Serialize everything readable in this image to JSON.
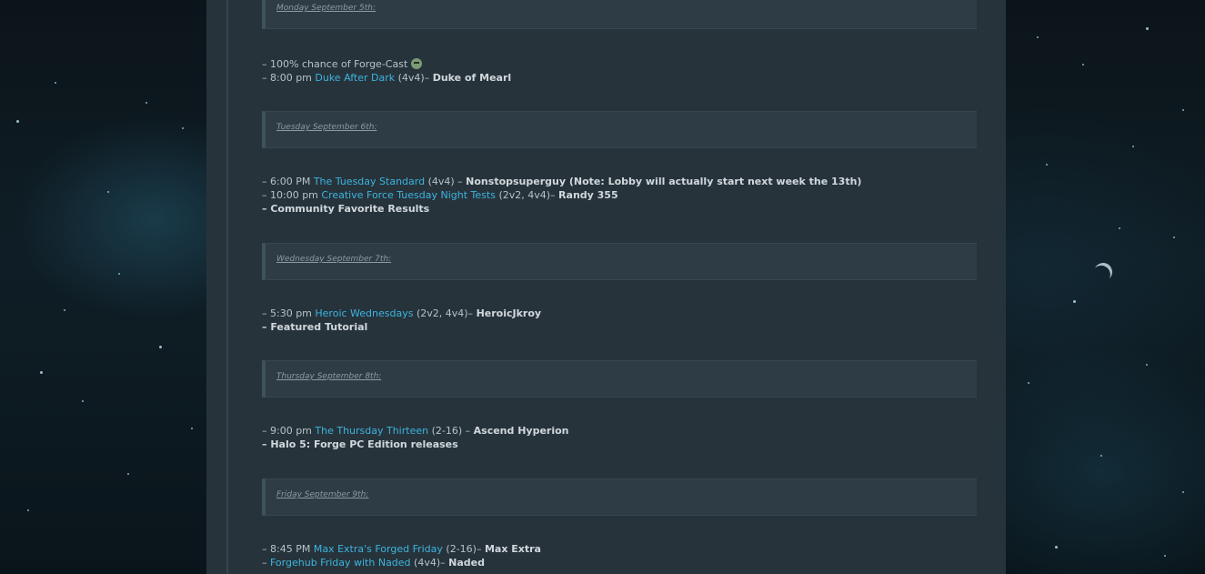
{
  "days": [
    {
      "header": "Monday September 5th:",
      "lines": [
        {
          "pre": "– 100% chance of Forge-Cast",
          "emoji": "smiley-icon"
        },
        {
          "pre": "– 8:00 pm ",
          "link": "Duke After Dark",
          "mid": " (4v4)– ",
          "bold": "Duke of Mearl"
        }
      ]
    },
    {
      "header": "Tuesday September 6th:",
      "lines": [
        {
          "pre": "– 6:00 PM ",
          "link": "The Tuesday Standard",
          "mid": " (4v4) – ",
          "bold": "Nonstopsuperguy (Note: Lobby will actually start next week the 13th)"
        },
        {
          "pre": "– 10:00 pm ",
          "link": "Creative Force Tuesday Night Tests",
          "mid": " (2v2, 4v4)– ",
          "bold": "Randy 355"
        },
        {
          "bold": "– Community Favorite Results"
        }
      ]
    },
    {
      "header": "Wednesday September 7th:",
      "lines": [
        {
          "pre": "– 5:30 pm ",
          "link": "Heroic Wednesdays",
          "mid": " (2v2, 4v4)– ",
          "bold": "HeroicJkroy"
        },
        {
          "bold": "– Featured Tutorial"
        }
      ]
    },
    {
      "header": "Thursday September 8th:",
      "lines": [
        {
          "pre": "– 9:00 pm ",
          "link": "The Thursday Thirteen",
          "mid": " (2-16) – ",
          "bold": "Ascend Hyperion"
        },
        {
          "bold": "– Halo 5: Forge PC Edition releases"
        }
      ]
    },
    {
      "header": "Friday September 9th:",
      "lines": [
        {
          "pre": "– 8:45 PM ",
          "link": "Max Extra's Forged Friday",
          "mid": " (2-16)– ",
          "bold": "Max Extra"
        },
        {
          "pre": "– ",
          "link": "Forgehub Friday with Naded",
          "mid": " (4v4)– ",
          "bold": "Naded"
        }
      ]
    }
  ]
}
